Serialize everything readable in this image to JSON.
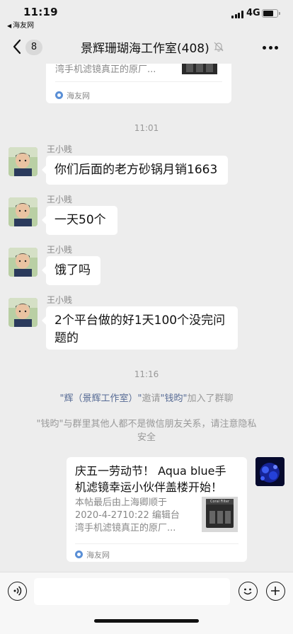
{
  "status_bar": {
    "time": "11:19",
    "back_app": "海友网",
    "network": "4G",
    "signal_bars": 4,
    "battery_level": 0.75
  },
  "nav": {
    "unread_count": "8",
    "title": "景辉珊瑚海工作室(408)",
    "icons": {
      "back": "chevron-left-icon",
      "mute": "bell-off-icon",
      "more": "more-dots-icon"
    }
  },
  "top_card": {
    "desc_tail": "湾手机滤镜真正的原厂...",
    "source": "海友网"
  },
  "timestamp_1": "11:01",
  "messages": [
    {
      "sender": "王小贱",
      "text": "你们后面的老方砂锅月销1663"
    },
    {
      "sender": "王小贱",
      "text": "一天50个"
    },
    {
      "sender": "王小贱",
      "text": "饿了吗"
    },
    {
      "sender": "王小贱",
      "text_line1": "2个平台做的好1天100个没完问",
      "text_line2": "题的"
    }
  ],
  "timestamp_2": "11:16",
  "system_join": {
    "inviter": "\"辉（景辉工作室）\"",
    "invite_word": "邀请",
    "invitee": "\"钱昀\"",
    "suffix": "加入了群聊"
  },
  "system_notice": {
    "line1": "\"钱昀\"与群里其他人都不是微信朋友关系，请注意隐私",
    "line2": "安全"
  },
  "bottom_card": {
    "title_line1": "庆五一劳动节！ Aqua blue手",
    "title_line2": "机滤镜幸运小伙伴盖楼开始！",
    "desc_line1": "本帖最后由上海卿顺于",
    "desc_line2": "2020-4-2710:22 编辑台",
    "desc_line3": "湾手机滤镜真正的原厂...",
    "source": "海友网",
    "thumb_label": "Coral Filter"
  },
  "input_bar": {
    "icons": {
      "voice": "voice-icon",
      "emoji": "emoji-icon",
      "add": "plus-icon"
    }
  },
  "colors": {
    "background": "#ededed",
    "link_blue": "#576b95",
    "bubble": "#ffffff",
    "muted_text": "#999999"
  }
}
